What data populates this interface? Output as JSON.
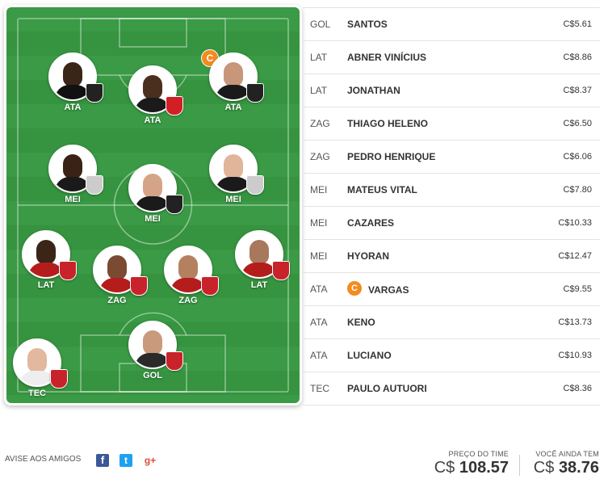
{
  "field": {
    "players": [
      {
        "id": "p1",
        "pos": "ATA",
        "skin": "#3b2418",
        "shirt": "#111111",
        "club": "atletico-mg",
        "clubColor": "#222222",
        "captain": false
      },
      {
        "id": "p2",
        "pos": "ATA",
        "skin": "#4a2e1e",
        "shirt": "#1a1a1a",
        "club": "sao-paulo",
        "clubColor": "#d21f26",
        "captain": false
      },
      {
        "id": "p3",
        "pos": "ATA",
        "skin": "#c8967a",
        "shirt": "#1a1a1a",
        "club": "atletico-mg",
        "clubColor": "#222222",
        "captain": true
      },
      {
        "id": "p4",
        "pos": "MEI",
        "skin": "#3a2316",
        "shirt": "#1a1a1a",
        "club": "corinthians",
        "clubColor": "#cccccc",
        "captain": false
      },
      {
        "id": "p5",
        "pos": "MEI",
        "skin": "#d5a488",
        "shirt": "#1a1a1a",
        "club": "atletico-mg",
        "clubColor": "#222222",
        "captain": false
      },
      {
        "id": "p6",
        "pos": "MEI",
        "skin": "#e0b59a",
        "shirt": "#1a1a1a",
        "club": "corinthians",
        "clubColor": "#cccccc",
        "captain": false
      },
      {
        "id": "p7",
        "pos": "LAT",
        "skin": "#3b2418",
        "shirt": "#b51d1d",
        "club": "athletico-pr",
        "clubColor": "#c8232b",
        "captain": false
      },
      {
        "id": "p8",
        "pos": "ZAG",
        "skin": "#7a4a32",
        "shirt": "#b51d1d",
        "club": "athletico-pr",
        "clubColor": "#c8232b",
        "captain": false
      },
      {
        "id": "p9",
        "pos": "ZAG",
        "skin": "#b5805f",
        "shirt": "#b51d1d",
        "club": "athletico-pr",
        "clubColor": "#c8232b",
        "captain": false
      },
      {
        "id": "p10",
        "pos": "LAT",
        "skin": "#a8785c",
        "shirt": "#b51d1d",
        "club": "athletico-pr",
        "clubColor": "#c8232b",
        "captain": false
      },
      {
        "id": "p11",
        "pos": "GOL",
        "skin": "#c99a7c",
        "shirt": "#2a2a2a",
        "club": "athletico-pr",
        "clubColor": "#c8232b",
        "captain": false
      },
      {
        "id": "p12",
        "pos": "TEC",
        "skin": "#e2b89e",
        "shirt": "#eeeeee",
        "club": "athletico-pr",
        "clubColor": "#c8232b",
        "captain": false
      }
    ],
    "captain_letter": "C"
  },
  "lineup": [
    {
      "pos": "GOL",
      "name": "SANTOS",
      "price": "C$5.61",
      "captain": false
    },
    {
      "pos": "LAT",
      "name": "ABNER VINÍCIUS",
      "price": "C$8.86",
      "captain": false
    },
    {
      "pos": "LAT",
      "name": "JONATHAN",
      "price": "C$8.37",
      "captain": false
    },
    {
      "pos": "ZAG",
      "name": "THIAGO HELENO",
      "price": "C$6.50",
      "captain": false
    },
    {
      "pos": "ZAG",
      "name": "PEDRO HENRIQUE",
      "price": "C$6.06",
      "captain": false
    },
    {
      "pos": "MEI",
      "name": "MATEUS VITAL",
      "price": "C$7.80",
      "captain": false
    },
    {
      "pos": "MEI",
      "name": "CAZARES",
      "price": "C$10.33",
      "captain": false
    },
    {
      "pos": "MEI",
      "name": "HYORAN",
      "price": "C$12.47",
      "captain": false
    },
    {
      "pos": "ATA",
      "name": "VARGAS",
      "price": "C$9.55",
      "captain": true
    },
    {
      "pos": "ATA",
      "name": "KENO",
      "price": "C$13.73",
      "captain": false
    },
    {
      "pos": "ATA",
      "name": "LUCIANO",
      "price": "C$10.93",
      "captain": false
    },
    {
      "pos": "TEC",
      "name": "PAULO AUTUORI",
      "price": "C$8.36",
      "captain": false
    }
  ],
  "footer": {
    "share_label": "AVISE AOS AMIGOS",
    "share_icons": {
      "facebook": "f",
      "twitter": "t",
      "googleplus": "g+"
    },
    "team_price_label": "PREÇO DO TIME",
    "team_price_currency": "C$",
    "team_price_value": "108.57",
    "remaining_label": "VOCÊ AINDA TEM",
    "remaining_currency": "C$",
    "remaining_value": "38.76"
  },
  "colors": {
    "captain": "#f38b1f",
    "field_green": "#3a9a45",
    "facebook": "#3b5998",
    "twitter": "#1da1f2",
    "googleplus": "#dd4b39"
  }
}
